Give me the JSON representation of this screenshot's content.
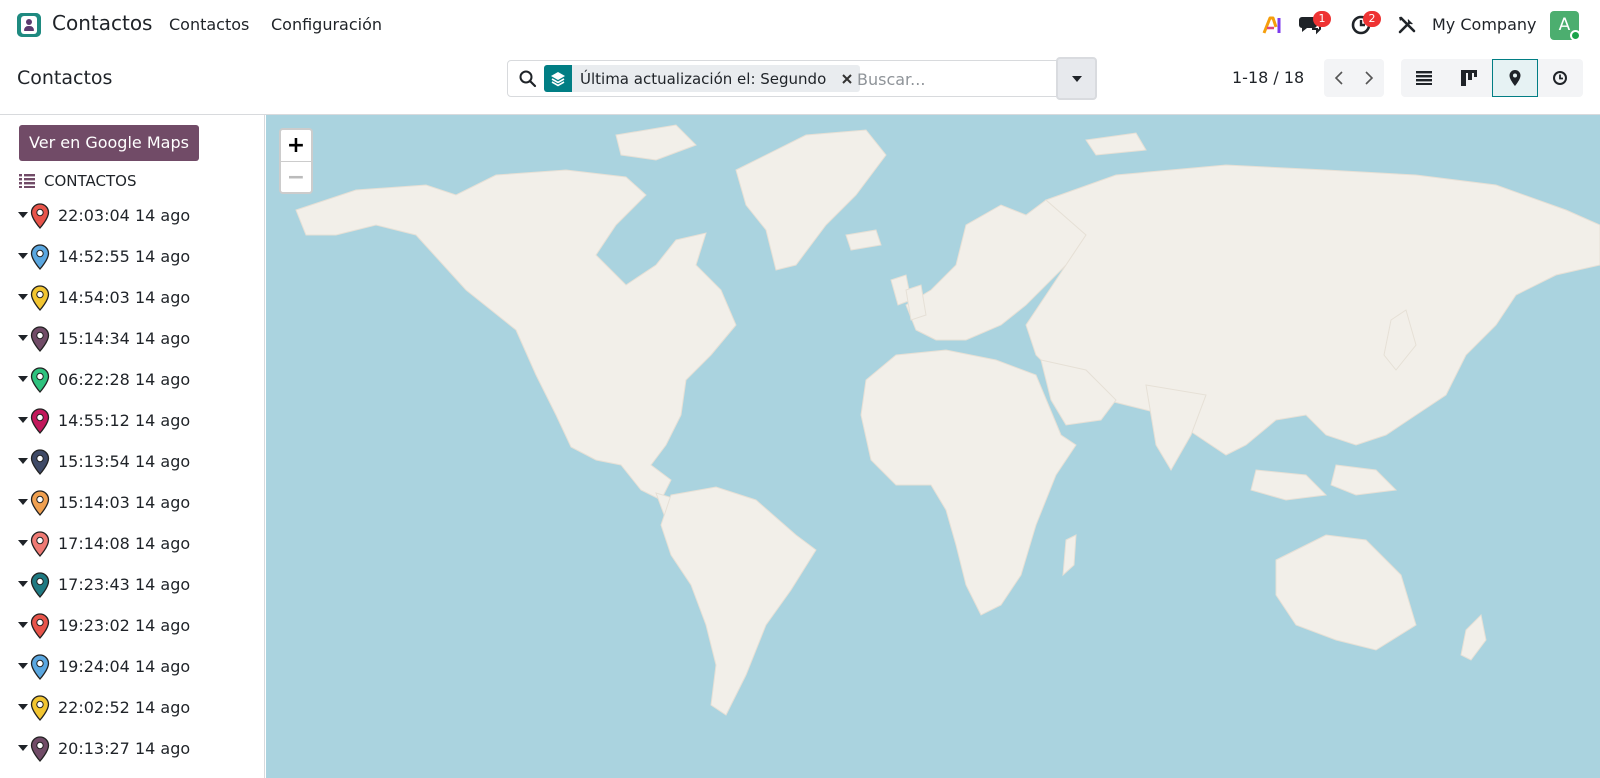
{
  "navbar": {
    "app_name": "Contactos",
    "menu": [
      "Contactos",
      "Configuración"
    ],
    "chat_badge": "1",
    "activity_badge": "2",
    "company": "My Company",
    "avatar_letter": "A"
  },
  "control_panel": {
    "title": "Contactos",
    "facet_label": "Última actualización el: Segundo",
    "search_placeholder": "Buscar...",
    "pager": "1-18 / 18",
    "views": [
      "list-icon",
      "kanban-icon",
      "map-pin-icon",
      "activity-clock-icon"
    ],
    "active_view": "map"
  },
  "sidebar": {
    "maps_button": "Ver en Google Maps",
    "section_label": "CONTACTOS",
    "records": [
      {
        "label": "22:03:04 14 ago",
        "color": "#e8544a"
      },
      {
        "label": "14:52:55 14 ago",
        "color": "#5aa7e0"
      },
      {
        "label": "14:54:03 14 ago",
        "color": "#f2c531"
      },
      {
        "label": "15:14:34 14 ago",
        "color": "#714b67"
      },
      {
        "label": "06:22:28 14 ago",
        "color": "#2ec27e"
      },
      {
        "label": "14:55:12 14 ago",
        "color": "#c2185b"
      },
      {
        "label": "15:13:54 14 ago",
        "color": "#3f4a67"
      },
      {
        "label": "15:14:03 14 ago",
        "color": "#f0a050"
      },
      {
        "label": "17:14:08 14 ago",
        "color": "#ef7a74"
      },
      {
        "label": "17:23:43 14 ago",
        "color": "#1f7a82"
      },
      {
        "label": "19:23:02 14 ago",
        "color": "#e8544a"
      },
      {
        "label": "19:24:04 14 ago",
        "color": "#5aa7e0"
      },
      {
        "label": "22:02:52 14 ago",
        "color": "#f2c531"
      },
      {
        "label": "20:13:27 14 ago",
        "color": "#714b67"
      }
    ]
  },
  "map": {
    "zoom_in": "+",
    "zoom_out": "−",
    "water_color": "#aad3df",
    "land_color": "#f2efe9"
  }
}
